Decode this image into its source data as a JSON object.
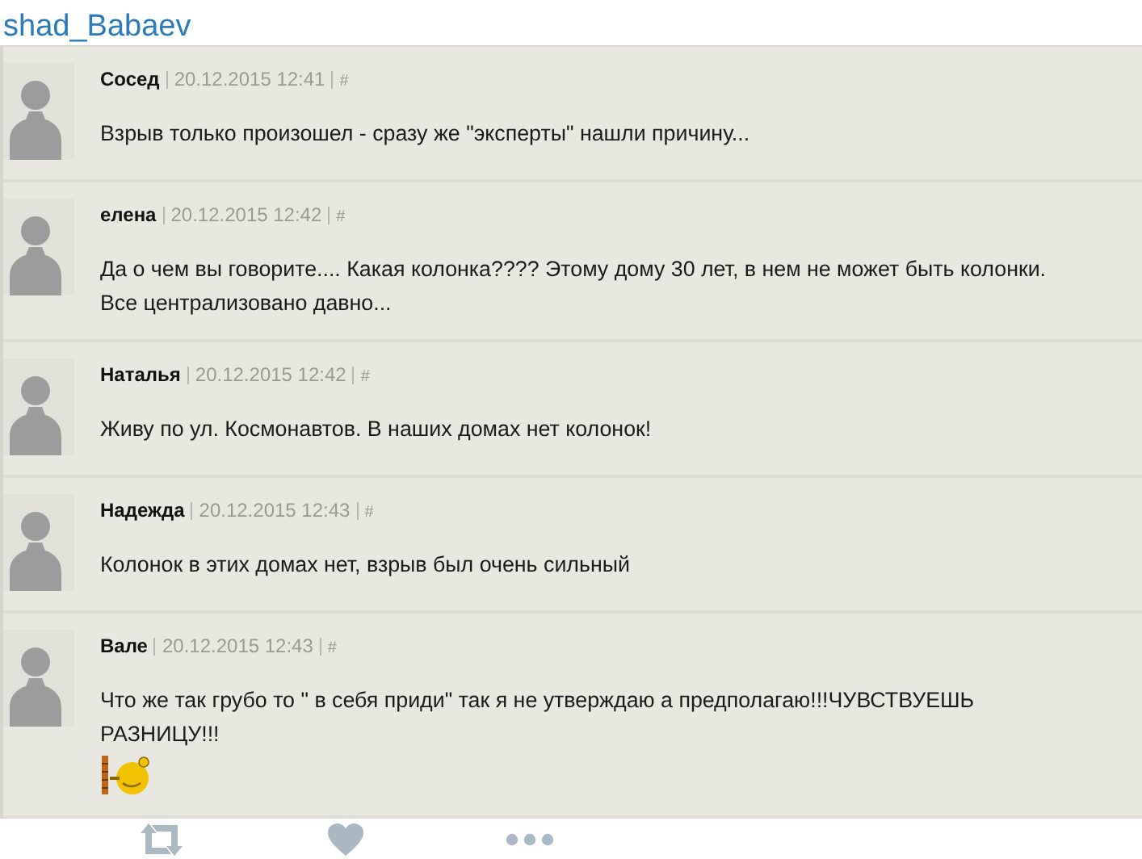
{
  "header": {
    "username": "shad_Babaev"
  },
  "comments": [
    {
      "author": "Сосед",
      "date": "20.12.2015 12:41",
      "anchor": "#",
      "text": "Взрыв только произошел - сразу же \"эксперты\" нашли причину...",
      "emoji": false
    },
    {
      "author": "елена",
      "date": "20.12.2015 12:42",
      "anchor": "#",
      "text": "Да о чем вы говорите.... Какая колонка???? Этому дому 30 лет, в нем не может быть колонки. Все централизовано давно...",
      "emoji": false
    },
    {
      "author": "Наталья",
      "date": "20.12.2015 12:42",
      "anchor": "#",
      "text": "Живу по ул. Космонавтов. В наших домах нет колонок!",
      "emoji": false
    },
    {
      "author": "Надежда",
      "date": "20.12.2015 12:43",
      "anchor": "#",
      "text": "Колонок в этих домах нет, взрыв был очень сильный",
      "emoji": false
    },
    {
      "author": "Вале",
      "date": "20.12.2015 12:43",
      "anchor": "#",
      "text": "Что же так грубо то \" в себя приди\" так я не утверждаю а предполагаю!!!ЧУВСТВУЕШЬ РАЗНИЦУ!!!",
      "emoji": true
    }
  ],
  "actions": [
    {
      "kind": "retweet"
    },
    {
      "kind": "like"
    },
    {
      "kind": "more"
    }
  ]
}
